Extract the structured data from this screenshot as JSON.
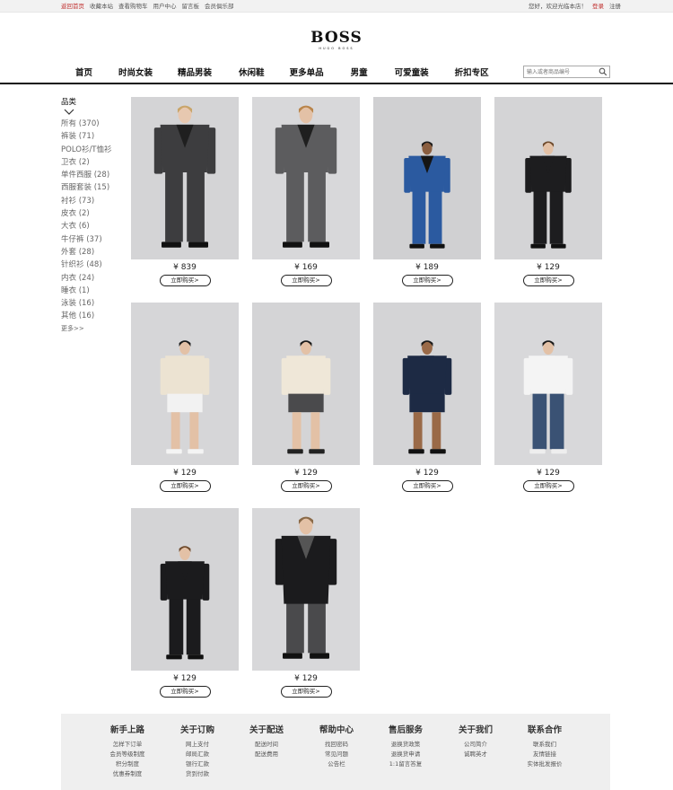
{
  "topbar": {
    "left_links": [
      "返回首页",
      "收藏本站",
      "查看购物车",
      "用户中心",
      "留言板",
      "会员俱乐部"
    ],
    "welcome": "您好，欢迎光临本店！",
    "login": "登录",
    "register": "注册"
  },
  "logo": {
    "brand": "BOSS",
    "sub": "HUGO BOSS"
  },
  "nav": {
    "items": [
      "首页",
      "时尚女装",
      "精品男装",
      "休闲鞋",
      "更多单品",
      "男童",
      "可爱童装",
      "折扣专区"
    ],
    "search_placeholder": "输入或者商品编号"
  },
  "sidebar": {
    "title": "品类",
    "categories": [
      "所有 (370)",
      "裤装 (71)",
      "POLO衫/T恤衫",
      "卫衣 (2)",
      "单件西服 (28)",
      "西服套装 (15)",
      "衬衫 (73)",
      "皮衣 (2)",
      "大衣 (6)",
      "牛仔裤 (37)",
      "外套 (28)",
      "针织衫 (48)",
      "内衣 (24)",
      "睡衣 (1)",
      "泳装 (16)",
      "其他 (16)"
    ],
    "more": "更多>>"
  },
  "products": [
    {
      "price": "¥ 839",
      "buy": "立即购买>",
      "palette": "charcoal-suit"
    },
    {
      "price": "¥ 169",
      "buy": "立即购买>",
      "palette": "grey-check-suit"
    },
    {
      "price": "¥ 189",
      "buy": "立即购买>",
      "palette": "blue-suit"
    },
    {
      "price": "¥ 129",
      "buy": "立即购买>",
      "palette": "black-suit"
    },
    {
      "price": "¥ 129",
      "buy": "立即购买>",
      "palette": "cream-tee-shorts"
    },
    {
      "price": "¥ 129",
      "buy": "立即购买>",
      "palette": "cream-jacket"
    },
    {
      "price": "¥ 129",
      "buy": "立即购买>",
      "palette": "navy-tracksuit"
    },
    {
      "price": "¥ 129",
      "buy": "立即购买>",
      "palette": "white-tee-blue-pants"
    },
    {
      "price": "¥ 129",
      "buy": "立即购买>",
      "palette": "black-slim-suit"
    },
    {
      "price": "¥ 129",
      "buy": "立即购买>",
      "palette": "black-coat"
    }
  ],
  "footer": [
    {
      "heading": "新手上路",
      "links": [
        "怎样下订单",
        "会员等级制度",
        "积分制度",
        "优惠券制度"
      ]
    },
    {
      "heading": "关于订购",
      "links": [
        "网上支付",
        "邮局汇款",
        "银行汇款",
        "货到付款"
      ]
    },
    {
      "heading": "关于配送",
      "links": [
        "配送时间",
        "配送费用"
      ]
    },
    {
      "heading": "帮助中心",
      "links": [
        "找回密码",
        "常见问题",
        "公告栏"
      ]
    },
    {
      "heading": "售后服务",
      "links": [
        "退换货政策",
        "退换货申请",
        "1:1留言答复"
      ]
    },
    {
      "heading": "关于我们",
      "links": [
        "公司简介",
        "诚聘英才"
      ]
    },
    {
      "heading": "联系合作",
      "links": [
        "联系我们",
        "友情链接",
        "实体批发报价"
      ]
    }
  ],
  "colors": {
    "accent": "#c0302f",
    "nav_border": "#111111",
    "footer_bg": "#efefef",
    "product_bg": "#d6d6d8"
  }
}
